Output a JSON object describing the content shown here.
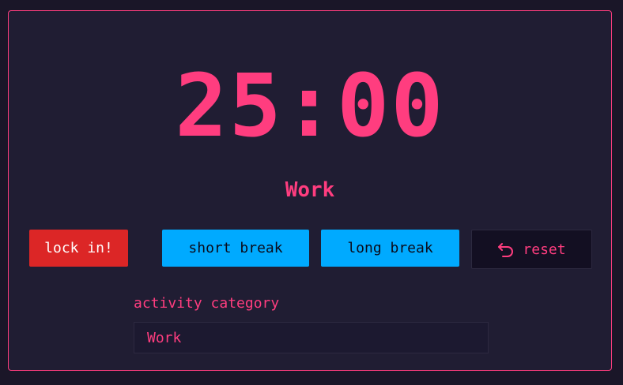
{
  "timer": {
    "display": "25:00"
  },
  "mode": {
    "label": "Work"
  },
  "buttons": {
    "lock_in": "lock in!",
    "short_break": "short break",
    "long_break": "long break",
    "reset": "reset",
    "reset_icon": "undo-arrow-icon"
  },
  "category": {
    "label": "activity category",
    "value": "Work"
  },
  "colors": {
    "background": "#1a1628",
    "panel": "#201d33",
    "accent": "#ff3d7f",
    "lock_in": "#dc2626",
    "break": "#00aaff",
    "reset_bg": "#130f22"
  }
}
